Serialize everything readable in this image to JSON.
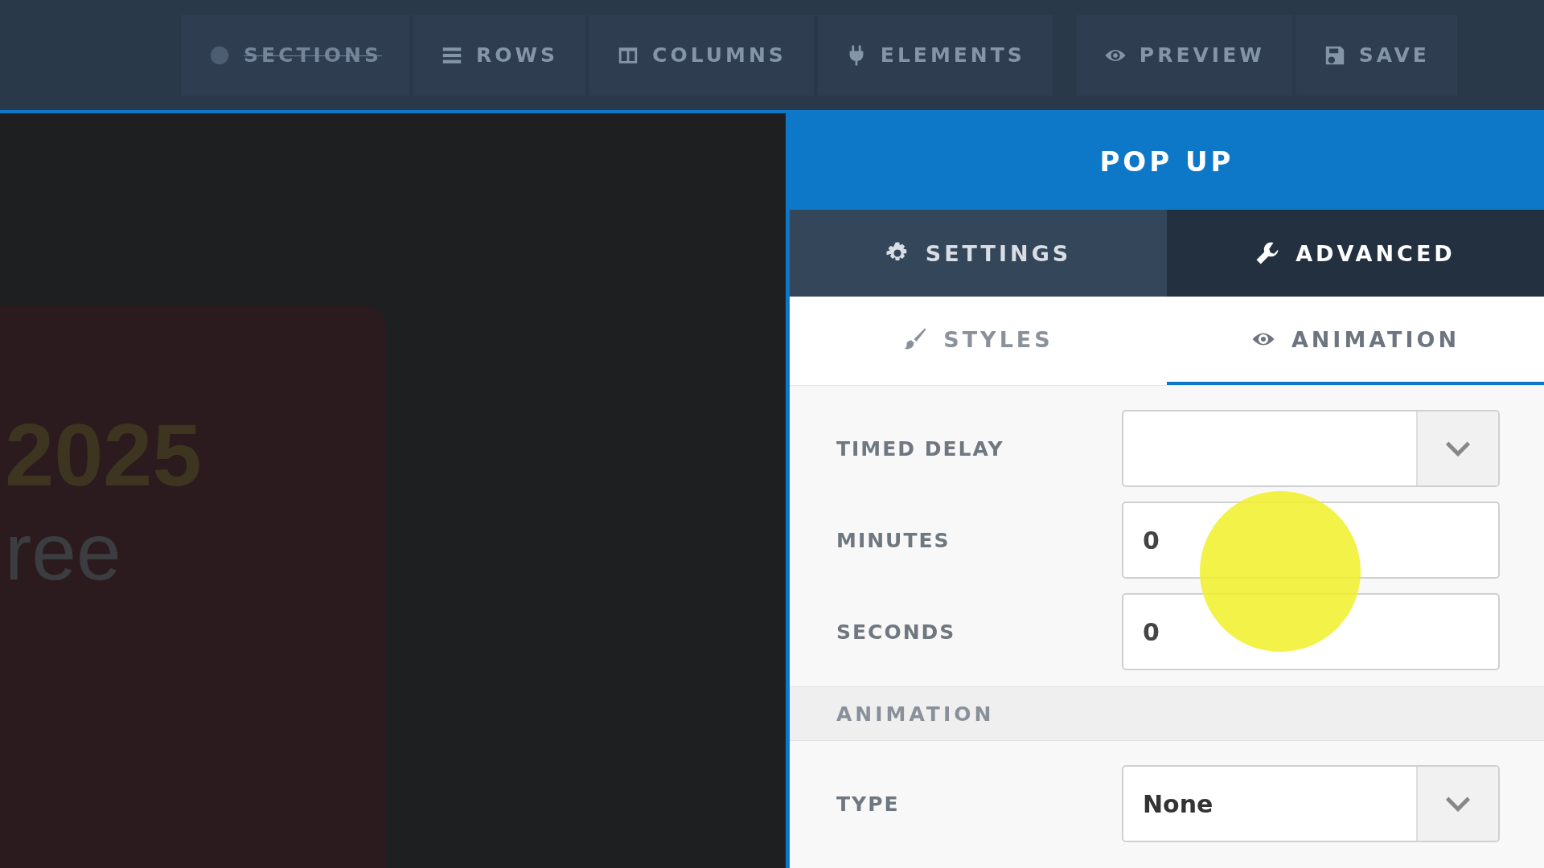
{
  "toolbar": {
    "groups": [
      [
        {
          "label": "SECTIONS",
          "disabled": true
        },
        {
          "label": "ROWS",
          "disabled": false
        },
        {
          "label": "COLUMNS",
          "disabled": false
        },
        {
          "label": "ELEMENTS",
          "disabled": false
        }
      ],
      [
        {
          "label": "PREVIEW",
          "disabled": false
        },
        {
          "label": "SAVE",
          "disabled": false
        }
      ]
    ]
  },
  "canvas": {
    "heading": "2025",
    "text": "ree"
  },
  "panel": {
    "title": "POP UP",
    "tabs": [
      {
        "label": "SETTINGS",
        "selected": false
      },
      {
        "label": "ADVANCED",
        "selected": true
      }
    ],
    "subtabs": [
      {
        "label": "STYLES",
        "selected": false
      },
      {
        "label": "ANIMATION",
        "selected": true
      }
    ],
    "fields": [
      {
        "kind": "select",
        "label": "TIMED DELAY"
      },
      {
        "kind": "number",
        "label": "MINUTES",
        "value": "0"
      },
      {
        "kind": "number",
        "label": "SECONDS",
        "value": "0"
      }
    ],
    "section": "ANIMATION",
    "section_fields": [
      {
        "kind": "select",
        "label": "TYPE",
        "value": "None"
      }
    ]
  }
}
